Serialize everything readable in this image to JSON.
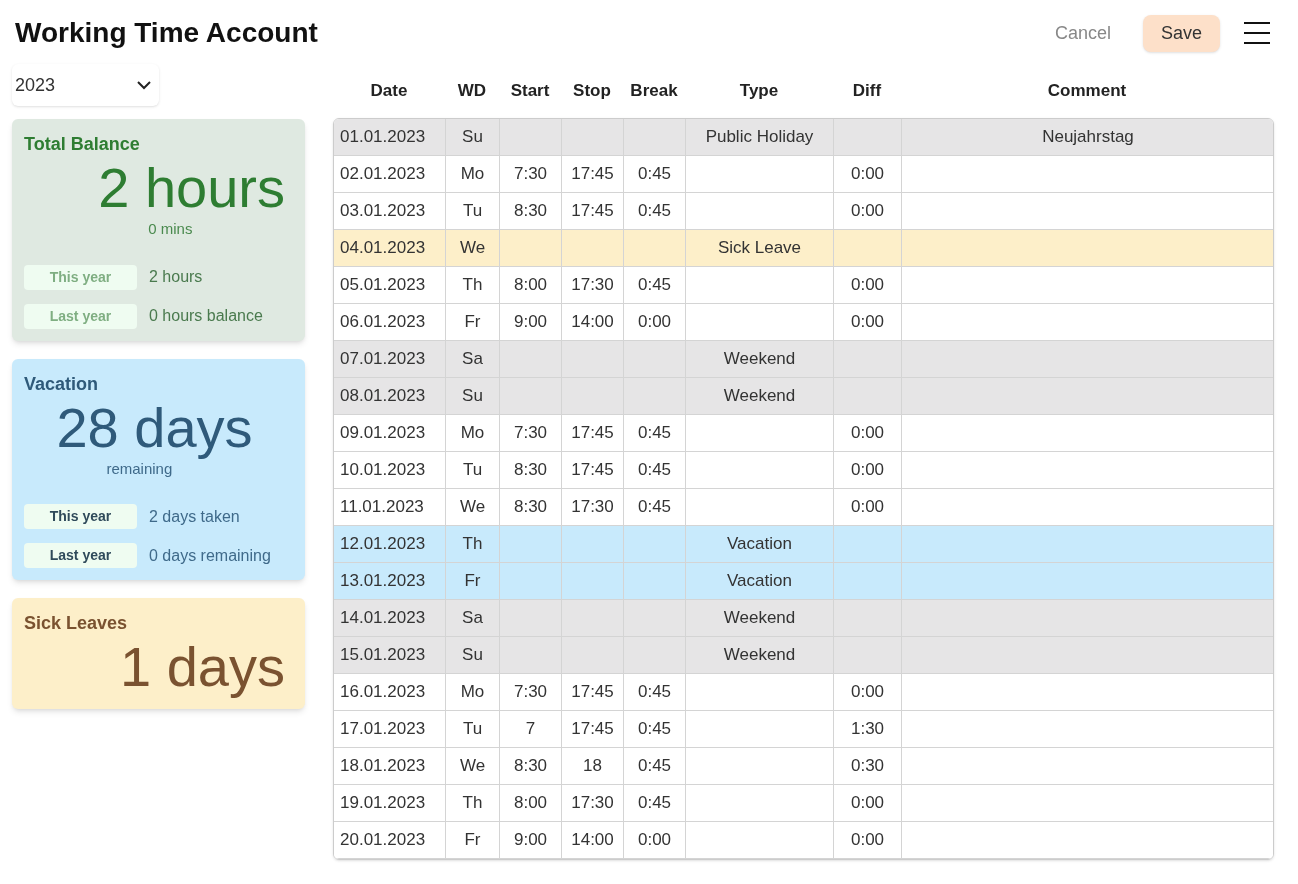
{
  "title": "Working Time Account",
  "actions": {
    "cancel": "Cancel",
    "save": "Save"
  },
  "year_select": {
    "value": "2023"
  },
  "cards": [
    {
      "kind": "balance",
      "title": "Total Balance",
      "value": "2 hours",
      "sub": "0 mins",
      "rows": [
        {
          "label": "This year",
          "value": "2 hours"
        },
        {
          "label": "Last year",
          "value": "0 hours balance"
        }
      ]
    },
    {
      "kind": "vacation",
      "title": "Vacation",
      "value": "28 days",
      "sub": "remaining",
      "rows": [
        {
          "label": "This year",
          "value": "2 days taken"
        },
        {
          "label": "Last year",
          "value": "0 days remaining"
        }
      ]
    },
    {
      "kind": "sick",
      "title": "Sick Leaves",
      "value": "1 days"
    }
  ],
  "table": {
    "columns": [
      "Date",
      "WD",
      "Start",
      "Stop",
      "Break",
      "Type",
      "Diff",
      "Comment"
    ],
    "rows": [
      {
        "kind": "holiday",
        "date": "01.01.2023",
        "wd": "Su",
        "type": "Public Holiday",
        "comment": "Neujahrstag"
      },
      {
        "kind": "work",
        "date": "02.01.2023",
        "wd": "Mo",
        "start": "7:30",
        "stop": "17:45",
        "break": "0:45",
        "diff": "0:00"
      },
      {
        "kind": "work",
        "date": "03.01.2023",
        "wd": "Tu",
        "start": "8:30",
        "stop": "17:45",
        "break": "0:45",
        "diff": "0:00"
      },
      {
        "kind": "sick",
        "date": "04.01.2023",
        "wd": "We",
        "type": "Sick Leave"
      },
      {
        "kind": "work",
        "date": "05.01.2023",
        "wd": "Th",
        "start": "8:00",
        "stop": "17:30",
        "break": "0:45",
        "diff": "0:00"
      },
      {
        "kind": "work",
        "date": "06.01.2023",
        "wd": "Fr",
        "start": "9:00",
        "stop": "14:00",
        "break": "0:00",
        "diff": "0:00"
      },
      {
        "kind": "weekend",
        "date": "07.01.2023",
        "wd": "Sa",
        "type": "Weekend"
      },
      {
        "kind": "weekend",
        "date": "08.01.2023",
        "wd": "Su",
        "type": "Weekend"
      },
      {
        "kind": "work",
        "date": "09.01.2023",
        "wd": "Mo",
        "start": "7:30",
        "stop": "17:45",
        "break": "0:45",
        "diff": "0:00"
      },
      {
        "kind": "work",
        "date": "10.01.2023",
        "wd": "Tu",
        "start": "8:30",
        "stop": "17:45",
        "break": "0:45",
        "diff": "0:00"
      },
      {
        "kind": "work",
        "date": "11.01.2023",
        "wd": "We",
        "start": "8:30",
        "stop": "17:30",
        "break": "0:45",
        "diff": "0:00"
      },
      {
        "kind": "vacation",
        "date": "12.01.2023",
        "wd": "Th",
        "type": "Vacation"
      },
      {
        "kind": "vacation",
        "date": "13.01.2023",
        "wd": "Fr",
        "type": "Vacation"
      },
      {
        "kind": "weekend",
        "date": "14.01.2023",
        "wd": "Sa",
        "type": "Weekend"
      },
      {
        "kind": "weekend",
        "date": "15.01.2023",
        "wd": "Su",
        "type": "Weekend"
      },
      {
        "kind": "work",
        "date": "16.01.2023",
        "wd": "Mo",
        "start": "7:30",
        "stop": "17:45",
        "break": "0:45",
        "diff": "0:00"
      },
      {
        "kind": "work",
        "date": "17.01.2023",
        "wd": "Tu",
        "start": "7",
        "stop": "17:45",
        "break": "0:45",
        "diff": "1:30"
      },
      {
        "kind": "work",
        "date": "18.01.2023",
        "wd": "We",
        "start": "8:30",
        "stop": "18",
        "break": "0:45",
        "diff": "0:30"
      },
      {
        "kind": "work",
        "date": "19.01.2023",
        "wd": "Th",
        "start": "8:00",
        "stop": "17:30",
        "break": "0:45",
        "diff": "0:00"
      },
      {
        "kind": "work",
        "date": "20.01.2023",
        "wd": "Fr",
        "start": "9:00",
        "stop": "14:00",
        "break": "0:00",
        "diff": "0:00"
      }
    ]
  }
}
